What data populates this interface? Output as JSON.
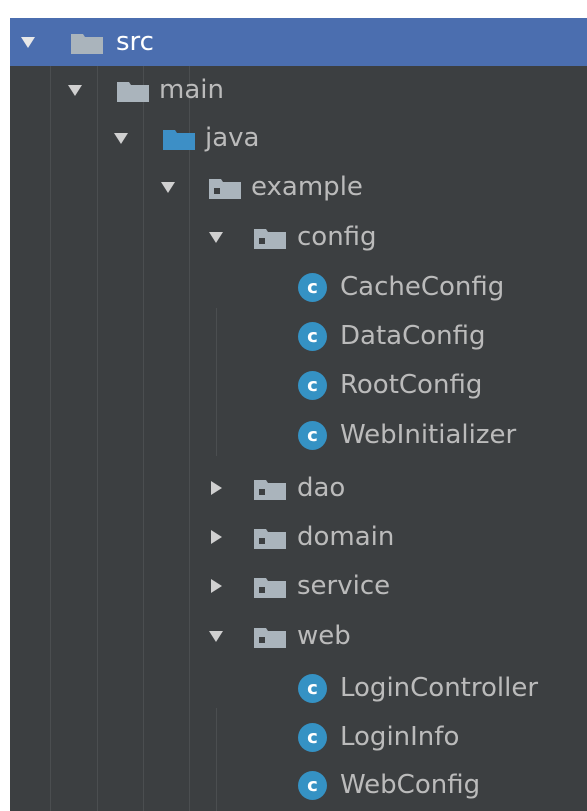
{
  "tree": {
    "src": "src",
    "main": "main",
    "java": "java",
    "example": "example",
    "config": "config",
    "cache_config": "CacheConfig",
    "data_config": "DataConfig",
    "root_config": "RootConfig",
    "web_initializer": "WebInitializer",
    "dao": "dao",
    "domain": "domain",
    "service": "service",
    "web": "web",
    "login_controller": "LoginController",
    "login_info": "LoginInfo",
    "web_config": "WebConfig"
  },
  "icons": {
    "expanded": "triangle-down-icon",
    "collapsed": "triangle-right-icon",
    "folder": "folder-icon",
    "source_folder": "source-folder-icon",
    "package": "package-icon",
    "class": "class-icon",
    "class_glyph": "c"
  },
  "colors": {
    "panel_bg": "#3c3f41",
    "selection": "#4b6eaf",
    "text": "#bbbbbb",
    "folder_gray": "#9aa7b0",
    "source_folder_blue": "#3d8fc6",
    "class_badge": "#3592c4"
  }
}
